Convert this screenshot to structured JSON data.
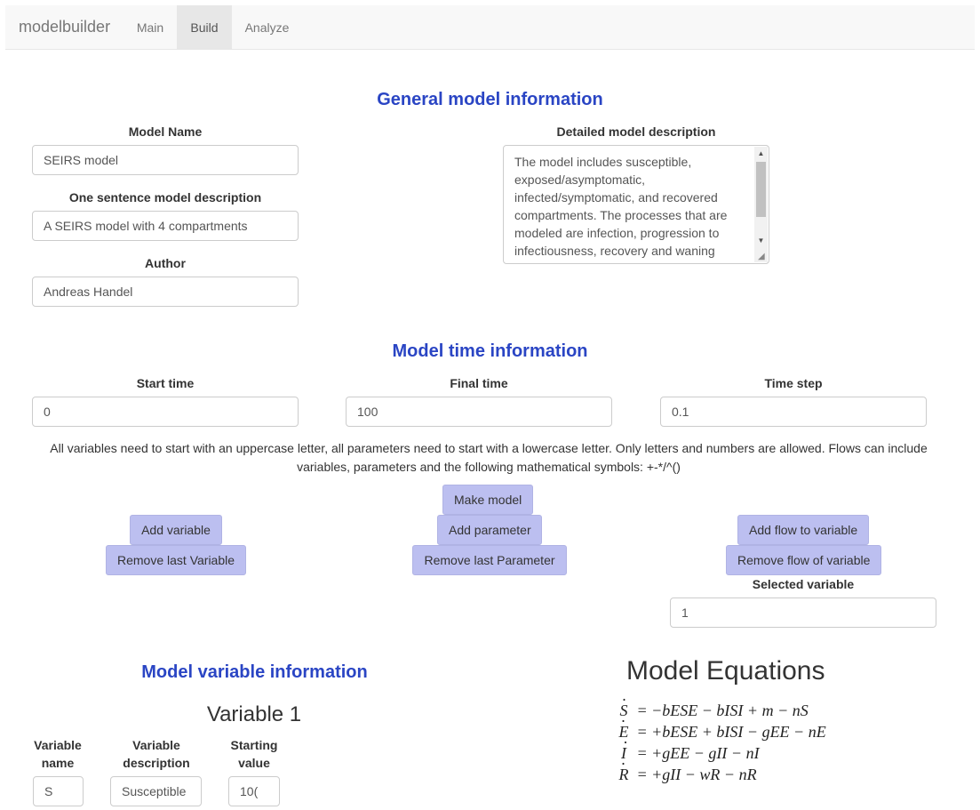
{
  "navbar": {
    "brand": "modelbuilder",
    "tabs": [
      {
        "label": "Main",
        "active": false
      },
      {
        "label": "Build",
        "active": true
      },
      {
        "label": "Analyze",
        "active": false
      }
    ]
  },
  "general": {
    "title": "General model information",
    "model_name_label": "Model Name",
    "model_name_value": "SEIRS model",
    "short_desc_label": "One sentence model description",
    "short_desc_value": "A SEIRS model with 4 compartments",
    "author_label": "Author",
    "author_value": "Andreas Handel",
    "detailed_label": "Detailed model description",
    "detailed_value": "The model includes susceptible, exposed/asymptomatic, infected/symptomatic, and recovered compartments. The processes that are modeled are infection, progression to infectiousness, recovery and waning immunity. Natural births and deaths are also included."
  },
  "time": {
    "title": "Model time information",
    "start_label": "Start time",
    "start_value": "0",
    "final_label": "Final time",
    "final_value": "100",
    "step_label": "Time step",
    "step_value": "0.1"
  },
  "instructions": "All variables need to start with an uppercase letter, all parameters need to start with a lowercase letter. Only letters and numbers are allowed. Flows can include variables, parameters and the following mathematical symbols: +-*/^()",
  "buttons": {
    "make_model": "Make model",
    "add_variable": "Add variable",
    "remove_variable": "Remove last Variable",
    "add_parameter": "Add parameter",
    "remove_parameter": "Remove last Parameter",
    "add_flow": "Add flow to variable",
    "remove_flow": "Remove flow of variable"
  },
  "selected_variable": {
    "label": "Selected variable",
    "value": "1"
  },
  "variables": {
    "title": "Model variable information",
    "heading": "Variable 1",
    "name_label_1": "Variable",
    "name_label_2": "name",
    "desc_label_1": "Variable",
    "desc_label_2": "description",
    "start_label_1": "Starting",
    "start_label_2": "value",
    "name_value": "S",
    "desc_value": "Susceptible",
    "start_value": "10("
  },
  "equations": {
    "title": "Model Equations",
    "items": [
      {
        "var": "S",
        "rhs": "= −bESE − bISI + m − nS"
      },
      {
        "var": "E",
        "rhs": "= +bESE + bISI − gEE − nE"
      },
      {
        "var": "I",
        "rhs": "= +gEE − gII − nI"
      },
      {
        "var": "R",
        "rhs": "= +gII − wR − nR"
      }
    ]
  }
}
